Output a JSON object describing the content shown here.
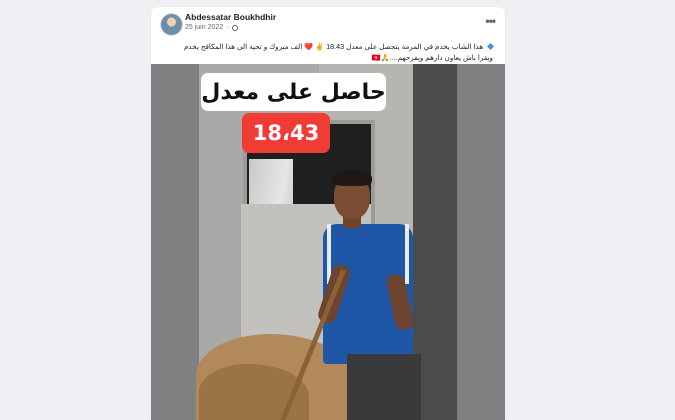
{
  "post": {
    "author": "Abdessatar Boukhdhir",
    "date": "25 juin 2022",
    "more_label": "•••",
    "caption_line1": "هذا الشاب يخدم في المرمة يتحصل على معدل  18.43 ✌️ ❤️ الف مبروك و تحية الى هذا المكافح يخدم",
    "caption_line2": "ويقرا باش يعاون دارهم ويفرحهم....🙏🇹🇳"
  },
  "photo": {
    "headline": "حاصل على معدل",
    "grade": "18،43"
  },
  "colors": {
    "grade_badge": "#f13b35",
    "shirt": "#1f56a6"
  }
}
